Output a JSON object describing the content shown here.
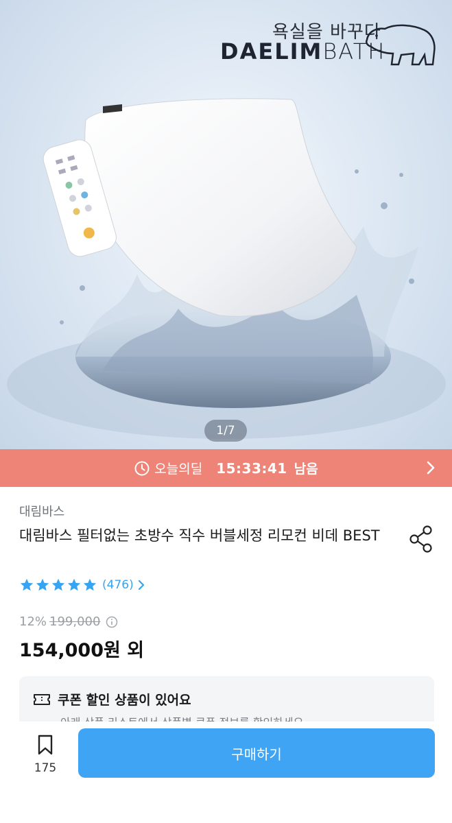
{
  "hero": {
    "brand_slogan": "욕실을 바꾸다",
    "brand_name_bold": "DAELIM",
    "brand_name_light": "BATH",
    "image_counter": "1/7"
  },
  "deal": {
    "label": "오늘의딜",
    "time_left": "15:33:41",
    "suffix": "남음"
  },
  "product": {
    "brand": "대림바스",
    "title": "대림바스 필터없는 초방수 직수 버블세정 리모컨 비데 BEST",
    "rating_stars": 5,
    "review_count": "(476)",
    "discount": "12%",
    "original_price": "199,000",
    "price": "154,000원 외"
  },
  "coupon": {
    "title": "쿠폰 할인 상품이 있어요",
    "subtitle": "아래 상품 리스트에서 상품별 쿠폰 정보를 확인하세요"
  },
  "bottom_bar": {
    "wishlist_count": "175",
    "buy_label": "구매하기"
  },
  "colors": {
    "deal_banner": "#ee8478",
    "buy_button": "#3ea4f3",
    "star": "#35a4f2"
  },
  "icons": [
    "clock-icon",
    "chevron-right-icon",
    "share-icon",
    "star-icon",
    "info-icon",
    "coupon-icon",
    "bookmark-icon",
    "bear-logo-icon"
  ]
}
